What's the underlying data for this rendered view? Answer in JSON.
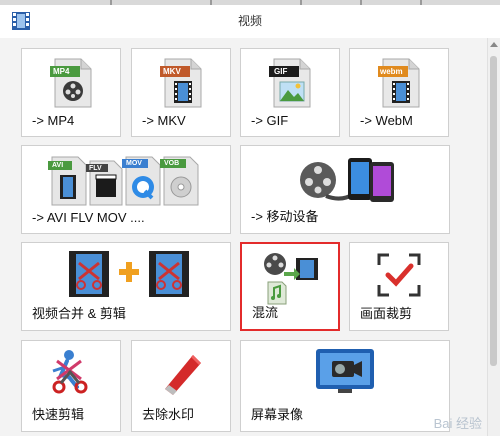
{
  "window": {
    "title": "视频"
  },
  "tiles": {
    "mp4": {
      "label": "-> MP4",
      "badge": "MP4"
    },
    "mkv": {
      "label": "-> MKV",
      "badge": "MKV"
    },
    "gif": {
      "label": "-> GIF",
      "badge": "GIF"
    },
    "webm": {
      "label": "-> WebM",
      "badge": "webm"
    },
    "multi": {
      "label": "-> AVI FLV MOV ....",
      "badges": [
        "AVI",
        "FLV",
        "MOV",
        "VOB"
      ]
    },
    "mobile": {
      "label": "-> 移动设备"
    },
    "merge": {
      "label": "视频合并 & 剪辑"
    },
    "mix": {
      "label": "混流"
    },
    "crop": {
      "label": "画面裁剪"
    },
    "quickcut": {
      "label": "快速剪辑"
    },
    "watermark": {
      "label": "去除水印"
    },
    "record": {
      "label": "屏幕录像"
    }
  },
  "watermark_text": "Bai 经验",
  "colors": {
    "selected_border": "#e32b2b",
    "accent_blue": "#2f6fc3",
    "accent_green": "#5aa64a"
  },
  "icons": {
    "app": "film-strip-icon",
    "mp4": "mp4-file-icon",
    "mkv": "mkv-file-icon",
    "gif": "gif-file-icon",
    "webm": "webm-file-icon",
    "multi": "multi-format-files-icon",
    "mobile": "film-reel-phones-icon",
    "merge": "film-plus-film-icon",
    "mix": "audio-video-mux-icon",
    "crop": "crop-check-icon",
    "quickcut": "scissors-figure-icon",
    "watermark": "eraser-icon",
    "record": "screen-record-icon"
  }
}
